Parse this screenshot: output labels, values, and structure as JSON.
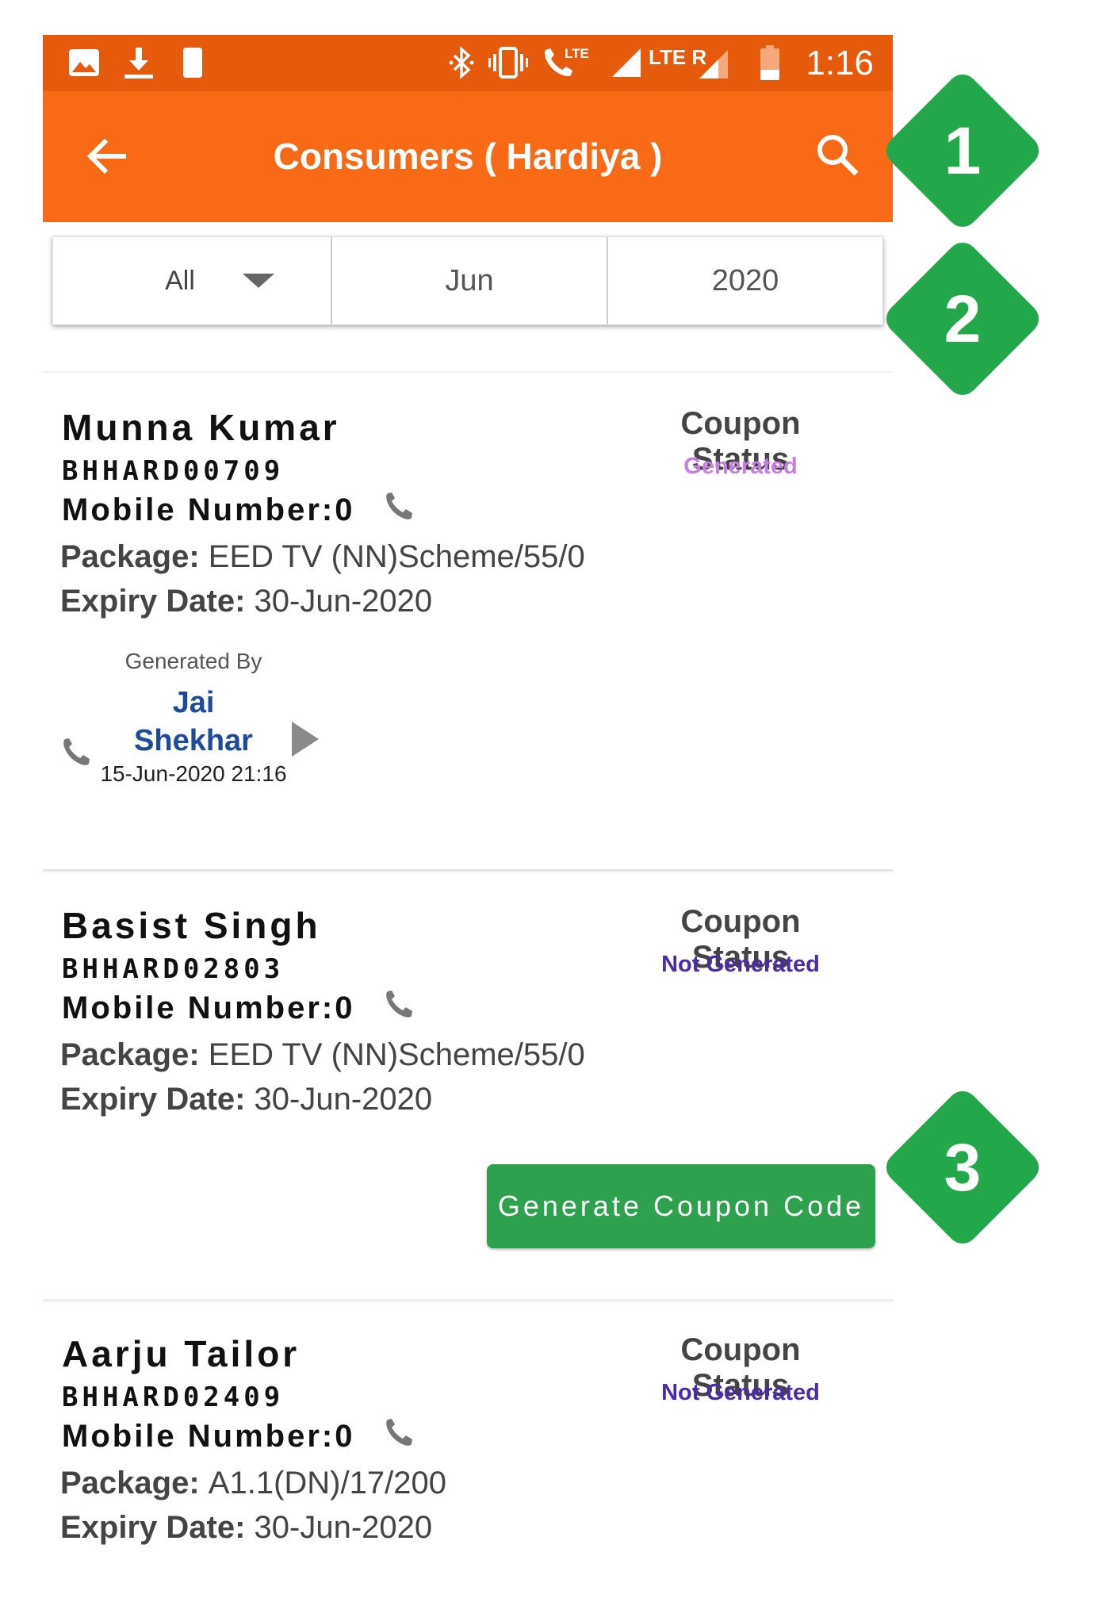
{
  "status_bar": {
    "time": "1:16",
    "left_icons": [
      "image-icon",
      "download-icon",
      "sim-card-icon"
    ],
    "right_icons": [
      "bluetooth-icon",
      "vibrate-icon",
      "lte-call-icon",
      "signal-icon",
      "lte-roaming-signal-icon",
      "battery-icon"
    ],
    "lte": "LTE",
    "lte_r": "LTE R"
  },
  "app_bar": {
    "title": "Consumers ( Hardiya )",
    "color": "#f96a17"
  },
  "filters": {
    "type": "All",
    "month": "Jun",
    "year": "2020"
  },
  "labels": {
    "mobile": "Mobile Number: ",
    "package": "Package: ",
    "expiry": "Expiry Date: ",
    "coupon_status": "Coupon Status",
    "generated_by": "Generated By"
  },
  "consumers": [
    {
      "name": "Munna Kumar",
      "id": "BHHARD00709",
      "mobile": "0",
      "package": "EED TV (NN)Scheme/55/0",
      "expiry": "30-Jun-2020",
      "coupon_status": "Generated",
      "status_color": "#c77fe0",
      "generated_by_first": "Jai",
      "generated_by_last": "Shekhar",
      "generated_at": "15-Jun-2020 21:16"
    },
    {
      "name": "Basist Singh",
      "id": "BHHARD02803",
      "mobile": "0",
      "package": "EED TV (NN)Scheme/55/0",
      "expiry": "30-Jun-2020",
      "coupon_status": "Not Generated",
      "status_color": "#4a2aa8",
      "action": "Generate Coupon Code"
    },
    {
      "name": "Aarju Tailor",
      "id": "BHHARD02409",
      "mobile": "0",
      "package": "A1.1(DN)/17/200",
      "expiry": "30-Jun-2020",
      "coupon_status": "Not Generated",
      "status_color": "#4a2aa8"
    }
  ],
  "callouts": [
    "1",
    "2",
    "3"
  ],
  "colors": {
    "status_bar": "#e55a0b",
    "accent": "#f96a17",
    "button": "#2ea14f",
    "callout": "#22a84a"
  }
}
